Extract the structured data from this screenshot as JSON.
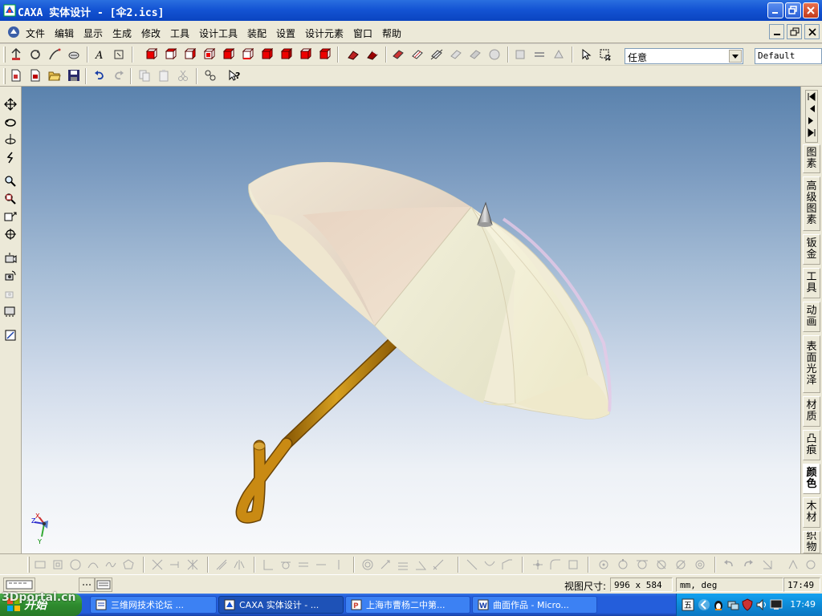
{
  "window": {
    "title": "CAXA 实体设计 - [伞2.ics]"
  },
  "menu": {
    "items": [
      "文件",
      "编辑",
      "显示",
      "生成",
      "修改",
      "工具",
      "设计工具",
      "装配",
      "设置",
      "设计元素",
      "窗口",
      "帮助"
    ]
  },
  "toolbar": {
    "selection_combo": {
      "value": "任意"
    },
    "style_combo": {
      "value": "Default"
    }
  },
  "palette_tabs": [
    "图素",
    "高级图素",
    "钣金",
    "工具",
    "动画",
    "表面光泽",
    "材质",
    "凸痕",
    "颜色",
    "木材",
    "织物"
  ],
  "palette_active": "颜色",
  "axes": {
    "x": "X",
    "y": "Y",
    "z": "Z"
  },
  "status": {
    "view_size_label": "视图尺寸:",
    "view_size_value": "996 x  584",
    "units": "mm, deg",
    "time": "17:49"
  },
  "taskbar": {
    "start_label": "开始",
    "tasks": [
      "三维网技术论坛 ...",
      "CAXA 实体设计 - ...",
      "上海市曹杨二中第...",
      "曲面作品 - Micro..."
    ],
    "clock": "17:49"
  },
  "watermark": "3Dportal.cn",
  "colors": {
    "titlebar": "#1454d4",
    "viewport_top": "#5a82ad",
    "viewport_bottom": "#f8f9fb",
    "handle": "#c98a13",
    "canopy": "#f3f0dc"
  }
}
